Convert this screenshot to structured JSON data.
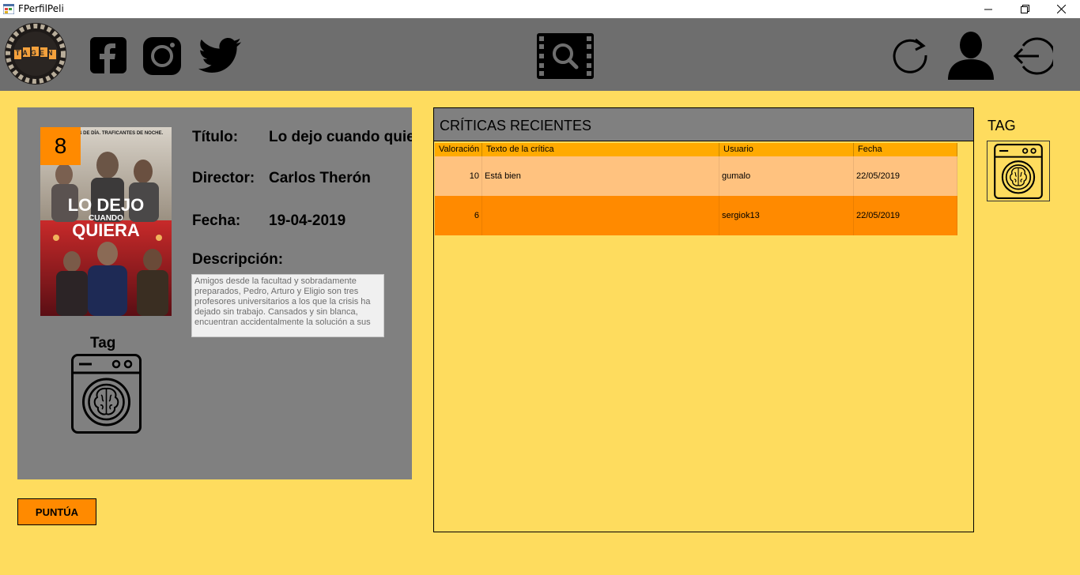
{
  "window": {
    "title": "FPerfilPeli"
  },
  "header": {
    "logo_text": "TAGEN",
    "icons": [
      "facebook-icon",
      "instagram-icon",
      "twitter-icon",
      "movie-search-icon",
      "refresh-icon",
      "user-icon",
      "logout-icon"
    ]
  },
  "movie": {
    "score": "8",
    "labels": {
      "title": "Título:",
      "director": "Director:",
      "date": "Fecha:",
      "description": "Descripción:",
      "tag": "Tag"
    },
    "title": "Lo dejo cuando quiera",
    "director": "Carlos Therón",
    "date": "19-04-2019",
    "description": "Amigos desde la facultad y sobradamente preparados, Pedro, Arturo y Eligio son tres profesores universitarios a los que la crisis ha dejado sin trabajo. Cansados y sin blanca, encuentran accidentalmente la solución a sus",
    "poster": {
      "top_text": "PROFESORES DE DÍA. TRAFICANTES DE NOCHE.",
      "title_line1": "LO DEJO",
      "title_line2": "CUANDO",
      "title_line3": "QUIERA"
    }
  },
  "actions": {
    "rate_button": "PUNTÚA"
  },
  "reviews": {
    "title": "CRÍTICAS RECIENTES",
    "columns": [
      "Valoración",
      "Texto de la crítica",
      "Usuario",
      "Fecha"
    ],
    "rows": [
      {
        "rating": "10",
        "text": "Está bien",
        "user": "gumalo",
        "date": "22/05/2019"
      },
      {
        "rating": "6",
        "text": "",
        "user": "sergiok13",
        "date": "22/05/2019"
      }
    ]
  },
  "side_tag": {
    "label": "TAG"
  },
  "colors": {
    "accent": "#FF8A00",
    "background": "#FEDC5E",
    "header": "#6E6E6E",
    "panel": "#808080"
  }
}
